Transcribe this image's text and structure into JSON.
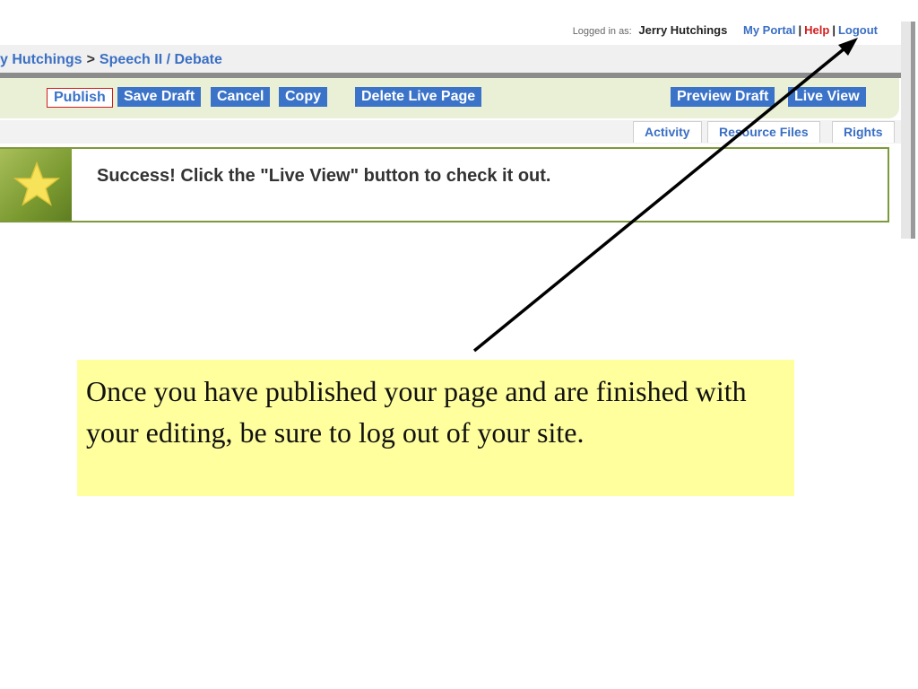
{
  "header": {
    "logged_in_label": "Logged in as:",
    "user_name": "Jerry Hutchings",
    "links": {
      "portal": "My Portal",
      "help": "Help",
      "logout": "Logout",
      "separator": "|"
    }
  },
  "breadcrumb": {
    "items": [
      "y Hutchings",
      "Speech II / Debate"
    ],
    "separator": ">"
  },
  "toolbar": {
    "publish": "Publish",
    "save_draft": "Save Draft",
    "cancel": "Cancel",
    "copy": "Copy",
    "delete_live_page": "Delete Live Page",
    "preview_draft": "Preview Draft",
    "live_view": "Live View"
  },
  "tabs": [
    "Activity",
    "Resource Files",
    "Rights"
  ],
  "success": {
    "message": "Success! Click the \"Live View\" button to check it out.",
    "icon": "star-icon"
  },
  "annotation": {
    "text": "Once you have published your page and are finished with your editing, be sure to log out of your site."
  },
  "colors": {
    "link_blue": "#3a6fc4",
    "button_blue": "#3b73c9",
    "toolbar_green": "#e9f0d6",
    "panel_border": "#7c9a3a",
    "help_red": "#d22020",
    "callout_yellow": "#ffff9e"
  }
}
